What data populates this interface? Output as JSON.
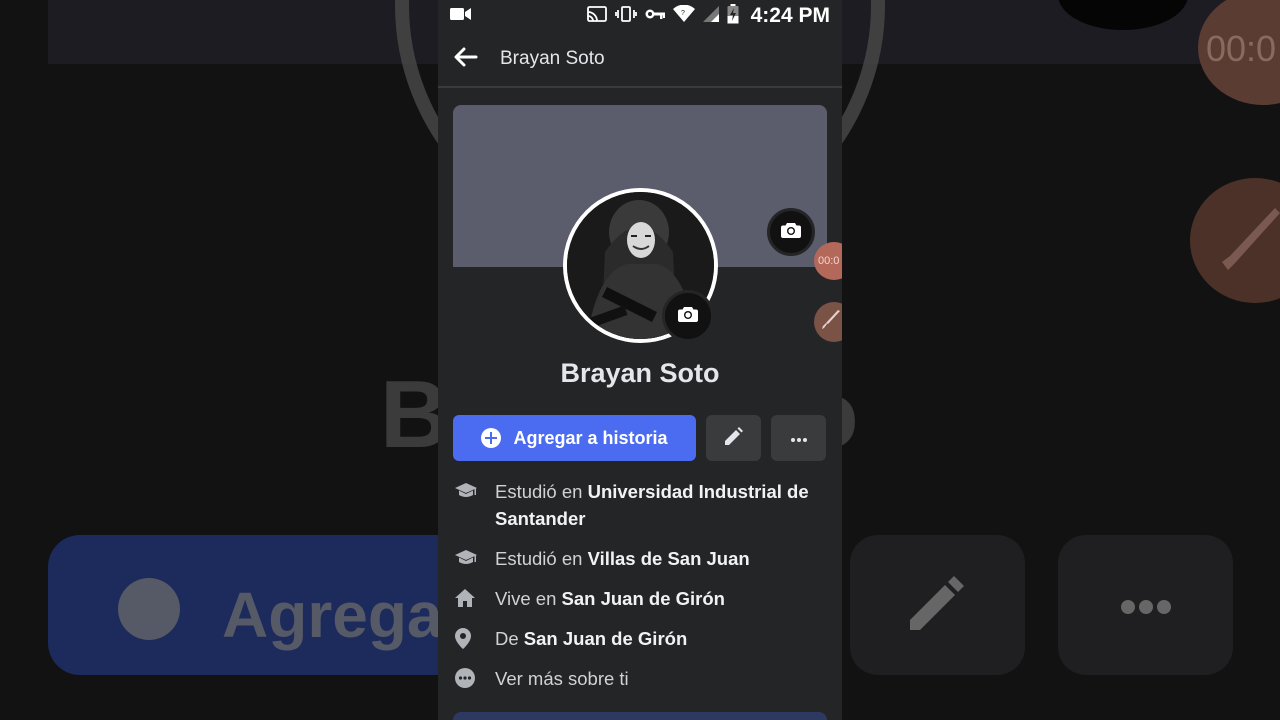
{
  "status_bar": {
    "time": "4:24 PM"
  },
  "app_bar": {
    "title": "Brayan Soto"
  },
  "profile": {
    "name": "Brayan Soto"
  },
  "actions": {
    "add_story_label": "Agregar a historia"
  },
  "overlay": {
    "timer_label": "00:0"
  },
  "details": [
    {
      "icon": "graduation-cap-icon",
      "prefix": "Estudió en",
      "value": "Universidad Industrial de Santander"
    },
    {
      "icon": "graduation-cap-icon",
      "prefix": "Estudió en",
      "value": "Villas de San Juan"
    },
    {
      "icon": "home-icon",
      "prefix": "Vive en",
      "value": "San Juan de Girón"
    },
    {
      "icon": "location-pin-icon",
      "prefix": "De",
      "value": "San Juan de Girón"
    },
    {
      "icon": "more-dots-icon",
      "prefix": "Ver más sobre ti",
      "value": ""
    }
  ],
  "backdrop": {
    "name_left": "B",
    "name_right": "o",
    "button_label": "Agregar",
    "timer_label": "00:0"
  },
  "colors": {
    "accent": "#4b6cf0",
    "surface": "#242526",
    "cover": "#5b5c6c"
  }
}
